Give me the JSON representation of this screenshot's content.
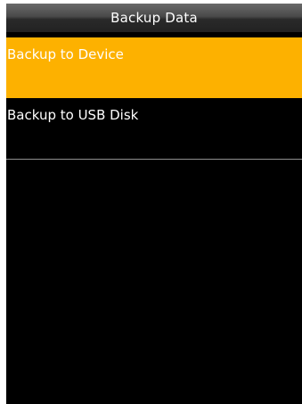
{
  "app": {
    "title": "Backup Data"
  },
  "menu": {
    "items": [
      {
        "label": "Backup to Device",
        "selected": true
      },
      {
        "label": "Backup to USB Disk",
        "selected": false
      }
    ]
  },
  "colors": {
    "selected_bg": "#fdb100",
    "screen_bg": "#000000",
    "title_text": "#ffffff"
  }
}
